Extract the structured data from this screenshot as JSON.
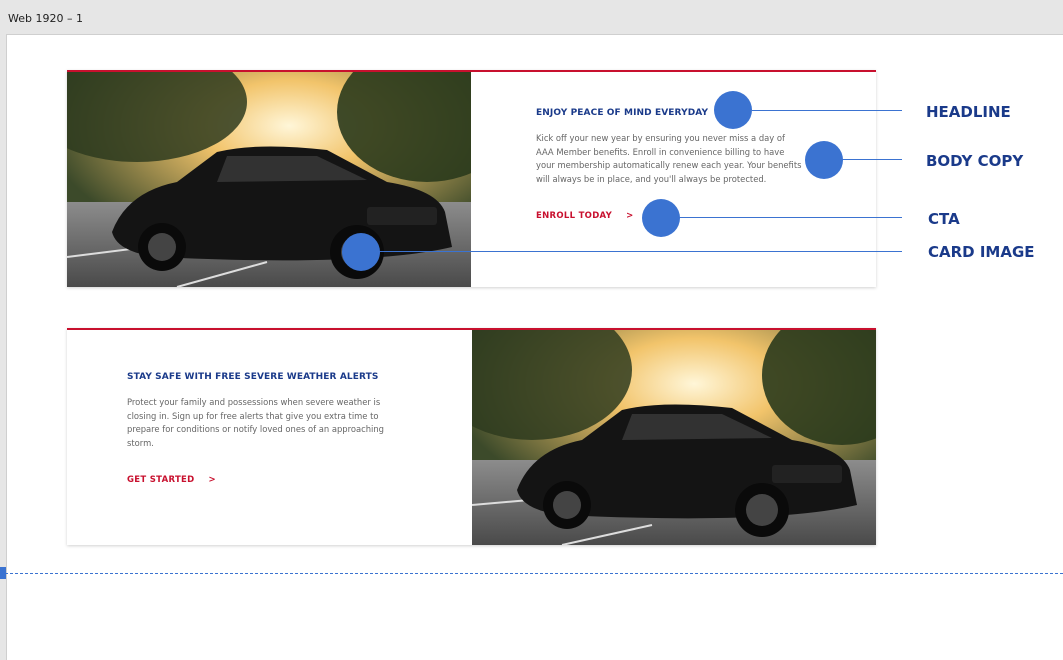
{
  "window": {
    "frame_label": "Web 1920 – 1"
  },
  "cards": [
    {
      "headline": "ENJOY PEACE OF MIND EVERYDAY",
      "body": "Kick off your new year by ensuring you never miss a day of AAA Member benefits. Enroll in convenience billing to have your membership automatically renew each year. Your benefits will always be in place, and you'll always be protected.",
      "cta": "ENROLL TODAY",
      "cta_chevron": ">"
    },
    {
      "headline": "STAY SAFE WITH FREE SEVERE WEATHER ALERTS",
      "body": "Protect your family and possessions when severe weather is closing in. Sign up for free alerts that give you extra time to prepare for conditions or notify loved ones of an approaching storm.",
      "cta": "GET STARTED",
      "cta_chevron": ">"
    }
  ],
  "annotations": {
    "headline": "HEADLINE",
    "body_copy": "BODY COPY",
    "cta": "CTA",
    "card_image": "CARD IMAGE"
  },
  "colors": {
    "accent_red": "#c8102e",
    "headline_blue": "#1a3a8a",
    "annotation_blue": "#3b73d1",
    "body_gray": "#666666"
  }
}
